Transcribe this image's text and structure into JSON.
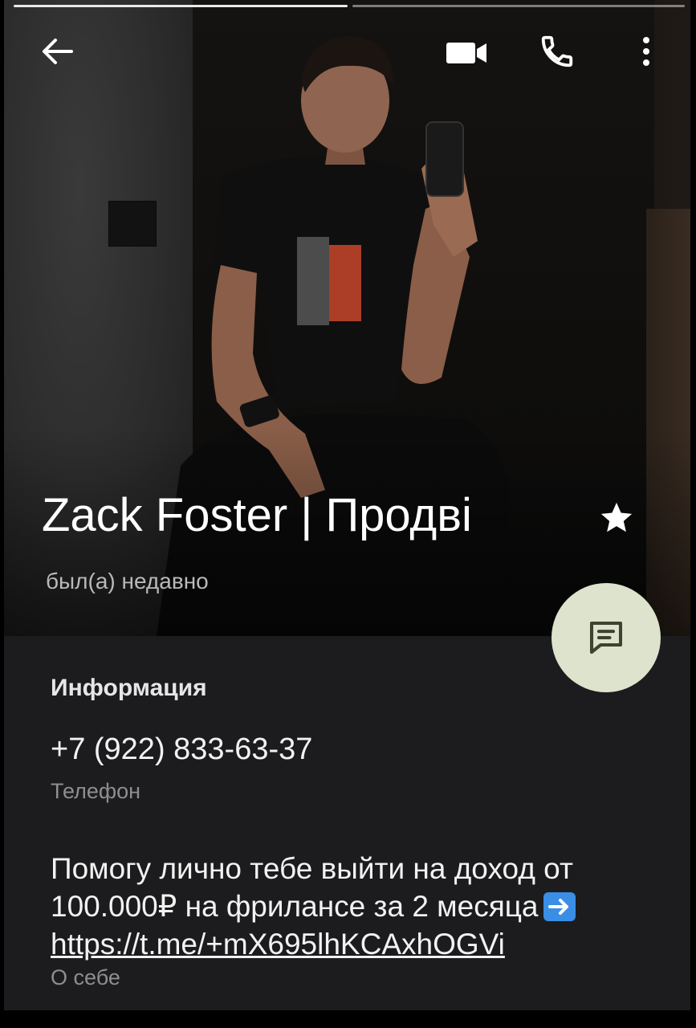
{
  "profile": {
    "name": "Zack Foster | Продві",
    "status": "был(а) недавно"
  },
  "info": {
    "section_title": "Информация",
    "phone": "+7 (922) 833-63-37",
    "phone_label": "Телефон",
    "bio_text": "Помогу лично тебе выйти на доход от 100.000₽ на фрилансе за 2 месяца",
    "bio_link": "https://t.me/+mX695lhKCAxhOGVi",
    "bio_label": "О себе"
  },
  "stories": {
    "total": 2,
    "current": 1
  },
  "icons": {
    "back": "arrow-left-icon",
    "video": "video-call-icon",
    "call": "phone-call-icon",
    "more": "more-vertical-icon",
    "star": "star-icon",
    "message": "message-icon",
    "arrow_emoji": "right-arrow-emoji"
  },
  "colors": {
    "background": "#1c1c1e",
    "fab": "#dde3cc",
    "muted_text": "#8e8e8e"
  }
}
